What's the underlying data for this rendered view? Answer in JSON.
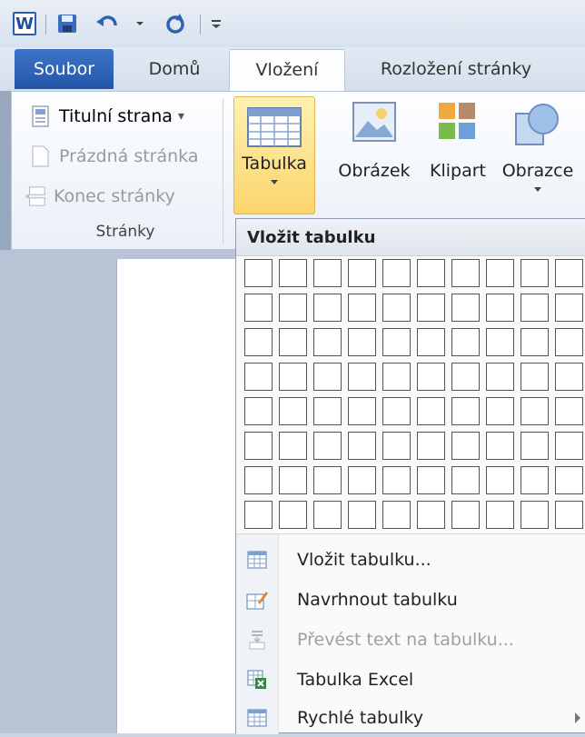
{
  "quick_access": {
    "app_icon_text": "W",
    "icons": [
      "word-app-icon",
      "save-icon",
      "undo-icon",
      "undo-dropdown-icon",
      "redo-icon",
      "customize-qat-icon"
    ]
  },
  "tabs": [
    {
      "label": "Soubor"
    },
    {
      "label": "Domů"
    },
    {
      "label": "Vložení"
    },
    {
      "label": "Rozložení stránky"
    }
  ],
  "ribbon": {
    "pages_group": {
      "items": [
        {
          "label": "Titulní strana",
          "suffix": "▾"
        },
        {
          "label": "Prázdná stránka"
        },
        {
          "label": "Konec stránky"
        }
      ],
      "group_label": "Stránky"
    },
    "table_button": {
      "label": "Tabulka"
    },
    "illustrations": [
      {
        "label": "Obrázek"
      },
      {
        "label": "Klipart"
      },
      {
        "label": "Obrazce"
      }
    ]
  },
  "dropdown": {
    "header": "Vložit tabulku",
    "grid": {
      "columns": 10,
      "rows": 8
    },
    "menu_items": [
      {
        "label": "Vložit tabulku..."
      },
      {
        "label": "Navrhnout tabulku"
      },
      {
        "label": "Převést text na tabulku..."
      },
      {
        "label": "Tabulka Excel"
      },
      {
        "label": "Rychlé tabulky"
      }
    ]
  },
  "colors": {
    "file_tab": "#2b5fb0",
    "highlight": "#fcd96b",
    "background": "#c9d3e1"
  }
}
